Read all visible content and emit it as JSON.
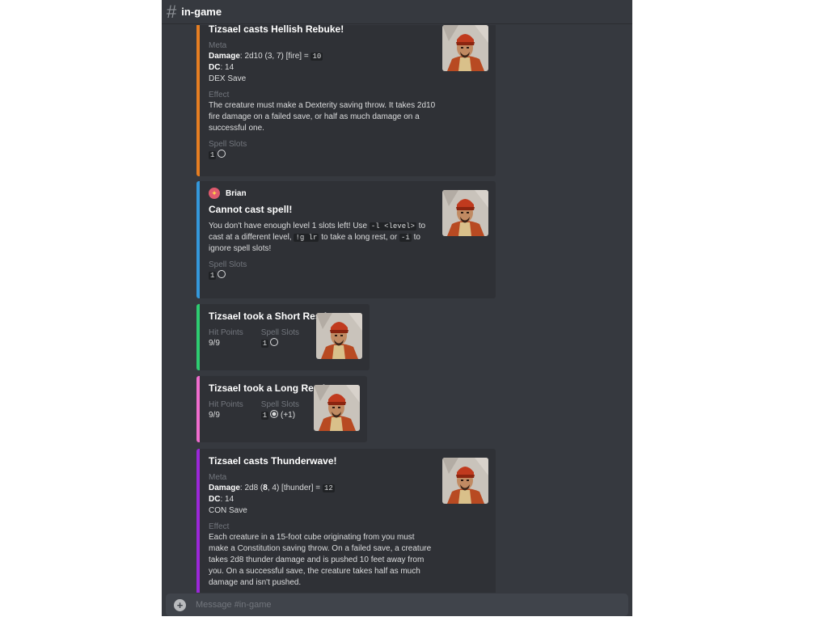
{
  "channel": {
    "name": "in-game",
    "hash_icon": "hash-icon"
  },
  "embeds": [
    {
      "color": "#e67e22",
      "title": "Tizsael casts Hellish Rebuke!",
      "meta_label": "Meta",
      "damage_label": "Damage",
      "damage_value": "2d10 (3, 7) [fire] =",
      "damage_total": "10",
      "dc_label": "DC",
      "dc_value": "14",
      "save": "DEX Save",
      "effect_label": "Effect",
      "effect_text": "The creature must make a Dexterity saving throw. It takes 2d10 fire damage on a failed save, or half as much damage on a successful one.",
      "slots_label": "Spell Slots",
      "slots_level": "1"
    },
    {
      "color": "#3498db",
      "author": "Brian",
      "title": "Cannot cast spell!",
      "text_1": "You don't have enough level 1 slots left! Use",
      "code_1": "-l <level>",
      "text_2": "to cast at a different level,",
      "code_2": "!g lr",
      "text_3": "to take a long rest, or",
      "code_3": "-i",
      "text_4": "to ignore spell slots!",
      "slots_label": "Spell Slots",
      "slots_level": "1"
    },
    {
      "color": "#2ecc71",
      "title": "Tizsael took a Short Rest!",
      "hp_label": "Hit Points",
      "hp_value": "9/9",
      "slots_label": "Spell Slots",
      "slots_level": "1"
    },
    {
      "color": "#f06dce",
      "title": "Tizsael took a Long Rest!",
      "hp_label": "Hit Points",
      "hp_value": "9/9",
      "slots_label": "Spell Slots",
      "slots_level": "1",
      "slots_delta": "(+1)"
    },
    {
      "color": "#9b27d8",
      "title": "Tizsael casts Thunderwave!",
      "meta_label": "Meta",
      "damage_label": "Damage",
      "damage_pre": "2d8 (",
      "damage_bold": "8",
      "damage_post": ", 4) [thunder] =",
      "damage_total": "12",
      "dc_label": "DC",
      "dc_value": "14",
      "save": "CON Save",
      "effect_label": "Effect",
      "effect_text": "Each creature in a 15-foot cube originating from you must make a Constitution saving throw. On a failed save, a creature takes 2d8 thunder damage and is pushed 10 feet away from you. On a successful save, the creature takes half as much damage and isn't pushed."
    }
  ],
  "composer": {
    "placeholder": "Message #in-game"
  }
}
